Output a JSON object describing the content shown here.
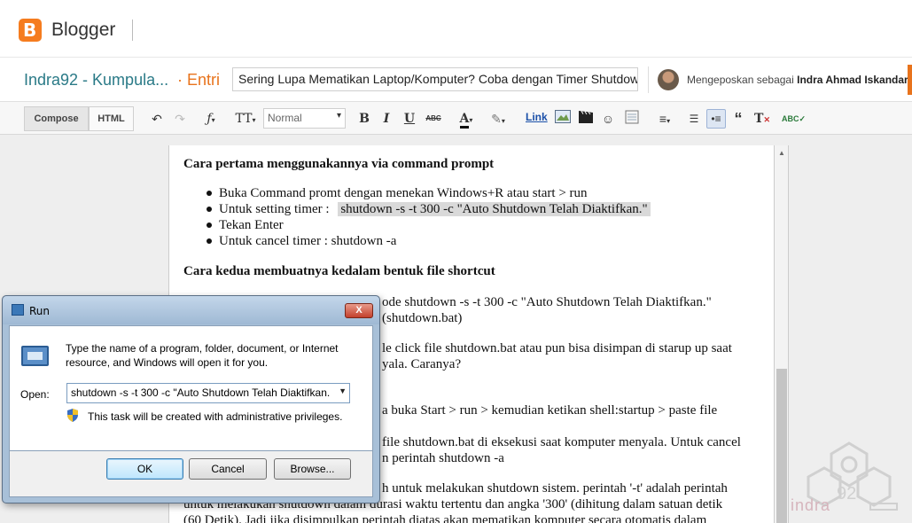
{
  "header": {
    "brand": "Blogger"
  },
  "postbar": {
    "blog_name": "Indra92 - Kumpula...",
    "separator": "·",
    "entry_label": "Entri",
    "post_title": "Sering Lupa Mematikan Laptop/Komputer? Coba dengan Timer Shutdown Oto",
    "posting_as_prefix": "Mengeposkan sebagai",
    "user_name": "Indra Ahmad Iskandar"
  },
  "toolbar": {
    "compose_label": "Compose",
    "html_label": "HTML",
    "format_value": "Normal",
    "link_label": "Link"
  },
  "editor": {
    "heading1": "Cara pertama menggunakannya via command prompt",
    "list": [
      "Buka Command promt dengan menekan Windows+R atau start > run",
      "Untuk setting timer :",
      "Tekan Enter",
      "Untuk cancel timer : shutdown -a"
    ],
    "timer_command": "shutdown -s -t 300 -c \"Auto Shutdown Telah Diaktifkan.\"",
    "heading2": "Cara kedua membuatnya kedalam bentuk file shortcut",
    "p1_line1": "ode shutdown -s -t 300 -c \"Auto Shutdown Telah Diaktifkan.\"",
    "p1_line2": "(shutdown.bat)",
    "p2_line1": "le click file shutdown.bat atau pun bisa disimpan di starup up saat",
    "p2_line2": "yala. Caranya?",
    "p3_line1": "a buka Start > run > kemudian ketikan shell:startup > paste file",
    "p4_line1": "file shutdown.bat di eksekusi saat komputer menyala. Untuk cancel",
    "p4_line2": "n perintah shutdown -a",
    "p5_line1": "h untuk melakukan shutdown sistem. perintah '-t' adalah perintah",
    "p5_line2": "untuk melakukan shutdown dalam durasi waktu tertentu dan angka '300' (dihitung dalam satuan detik",
    "p5_line3": "(60 Detik). Jadi jika disimpulkan perintah diatas akan mematikan komputer secara otomatis dalam"
  },
  "watermark": {
    "text": "indra",
    "number": "92"
  },
  "run_dialog": {
    "title": "Run",
    "close_symbol": "X",
    "description": "Type the name of a program, folder, document, or Internet resource, and Windows will open it for you.",
    "open_label": "Open:",
    "open_value": "shutdown -s -t 300 -c \"Auto Shutdown Telah Diaktifkan.",
    "admin_note": "This task will be created with administrative privileges.",
    "ok_label": "OK",
    "cancel_label": "Cancel",
    "browse_label": "Browse..."
  },
  "colors": {
    "brand_orange": "#f57c1f",
    "blog_teal": "#2a7a87",
    "entry_orange": "#e8731c",
    "link_blue": "#1a4fa8"
  }
}
